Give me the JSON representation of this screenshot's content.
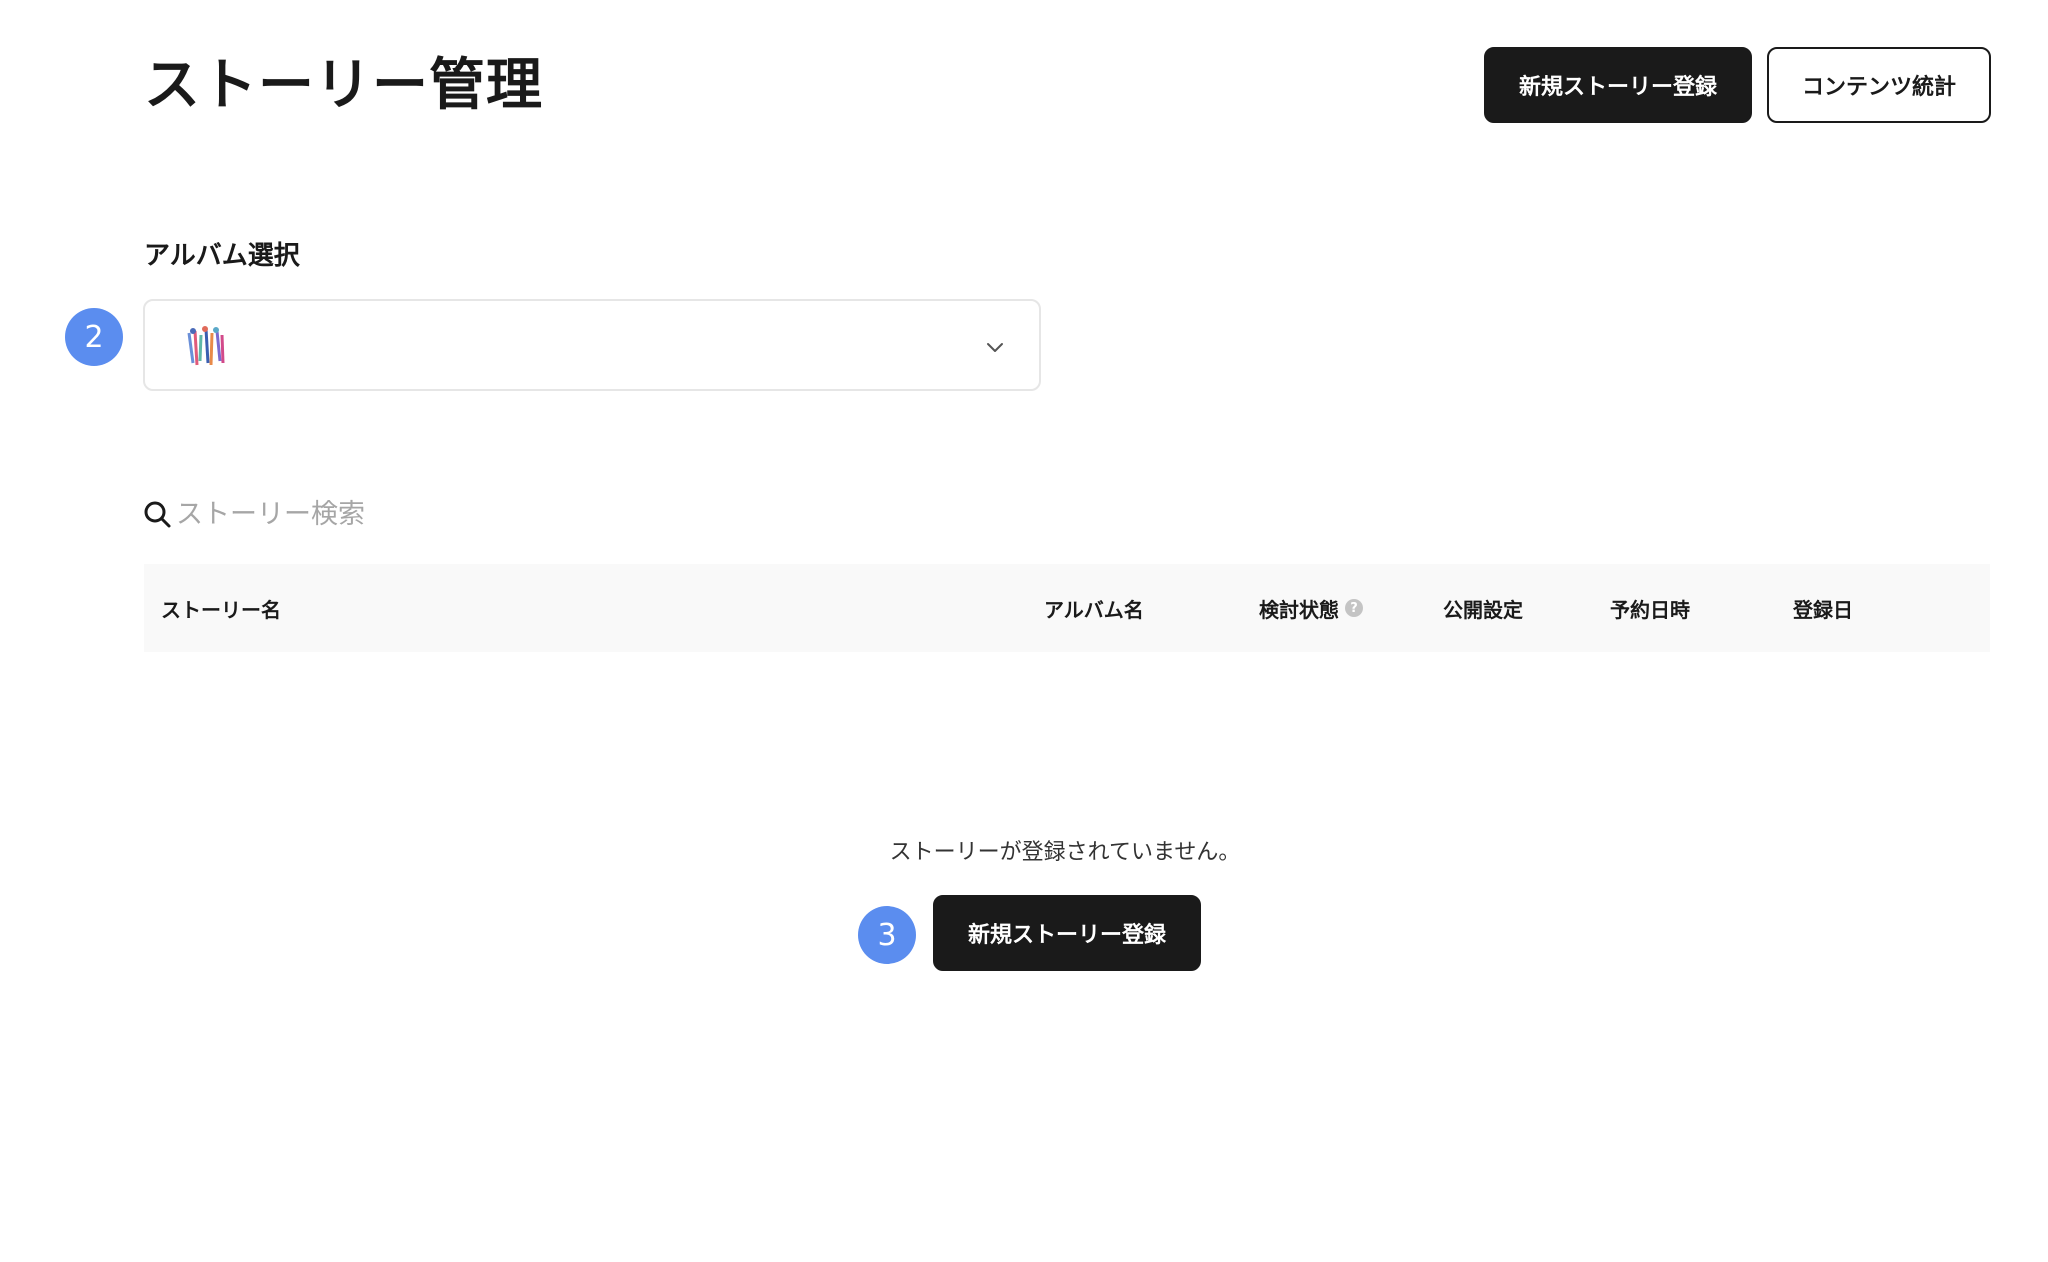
{
  "header": {
    "title": "ストーリー管理",
    "new_story_label": "新規ストーリー登録",
    "stats_label": "コンテンツ統計"
  },
  "album": {
    "label": "アルバム選択",
    "selected_icon": "album-cover-thumbnail",
    "marker": "2"
  },
  "search": {
    "placeholder": "ストーリー検索",
    "value": ""
  },
  "table": {
    "columns": [
      "ストーリー名",
      "アルバム名",
      "検討状態",
      "公開設定",
      "予約日時",
      "登録日"
    ],
    "help_glyph": "?",
    "rows": []
  },
  "empty": {
    "message": "ストーリーが登録されていません。",
    "button_label": "新規ストーリー登録",
    "marker": "3"
  },
  "colors": {
    "primary_button": "#1a1a1a",
    "marker": "#5b8def",
    "table_header_bg": "#f9f9f9"
  }
}
